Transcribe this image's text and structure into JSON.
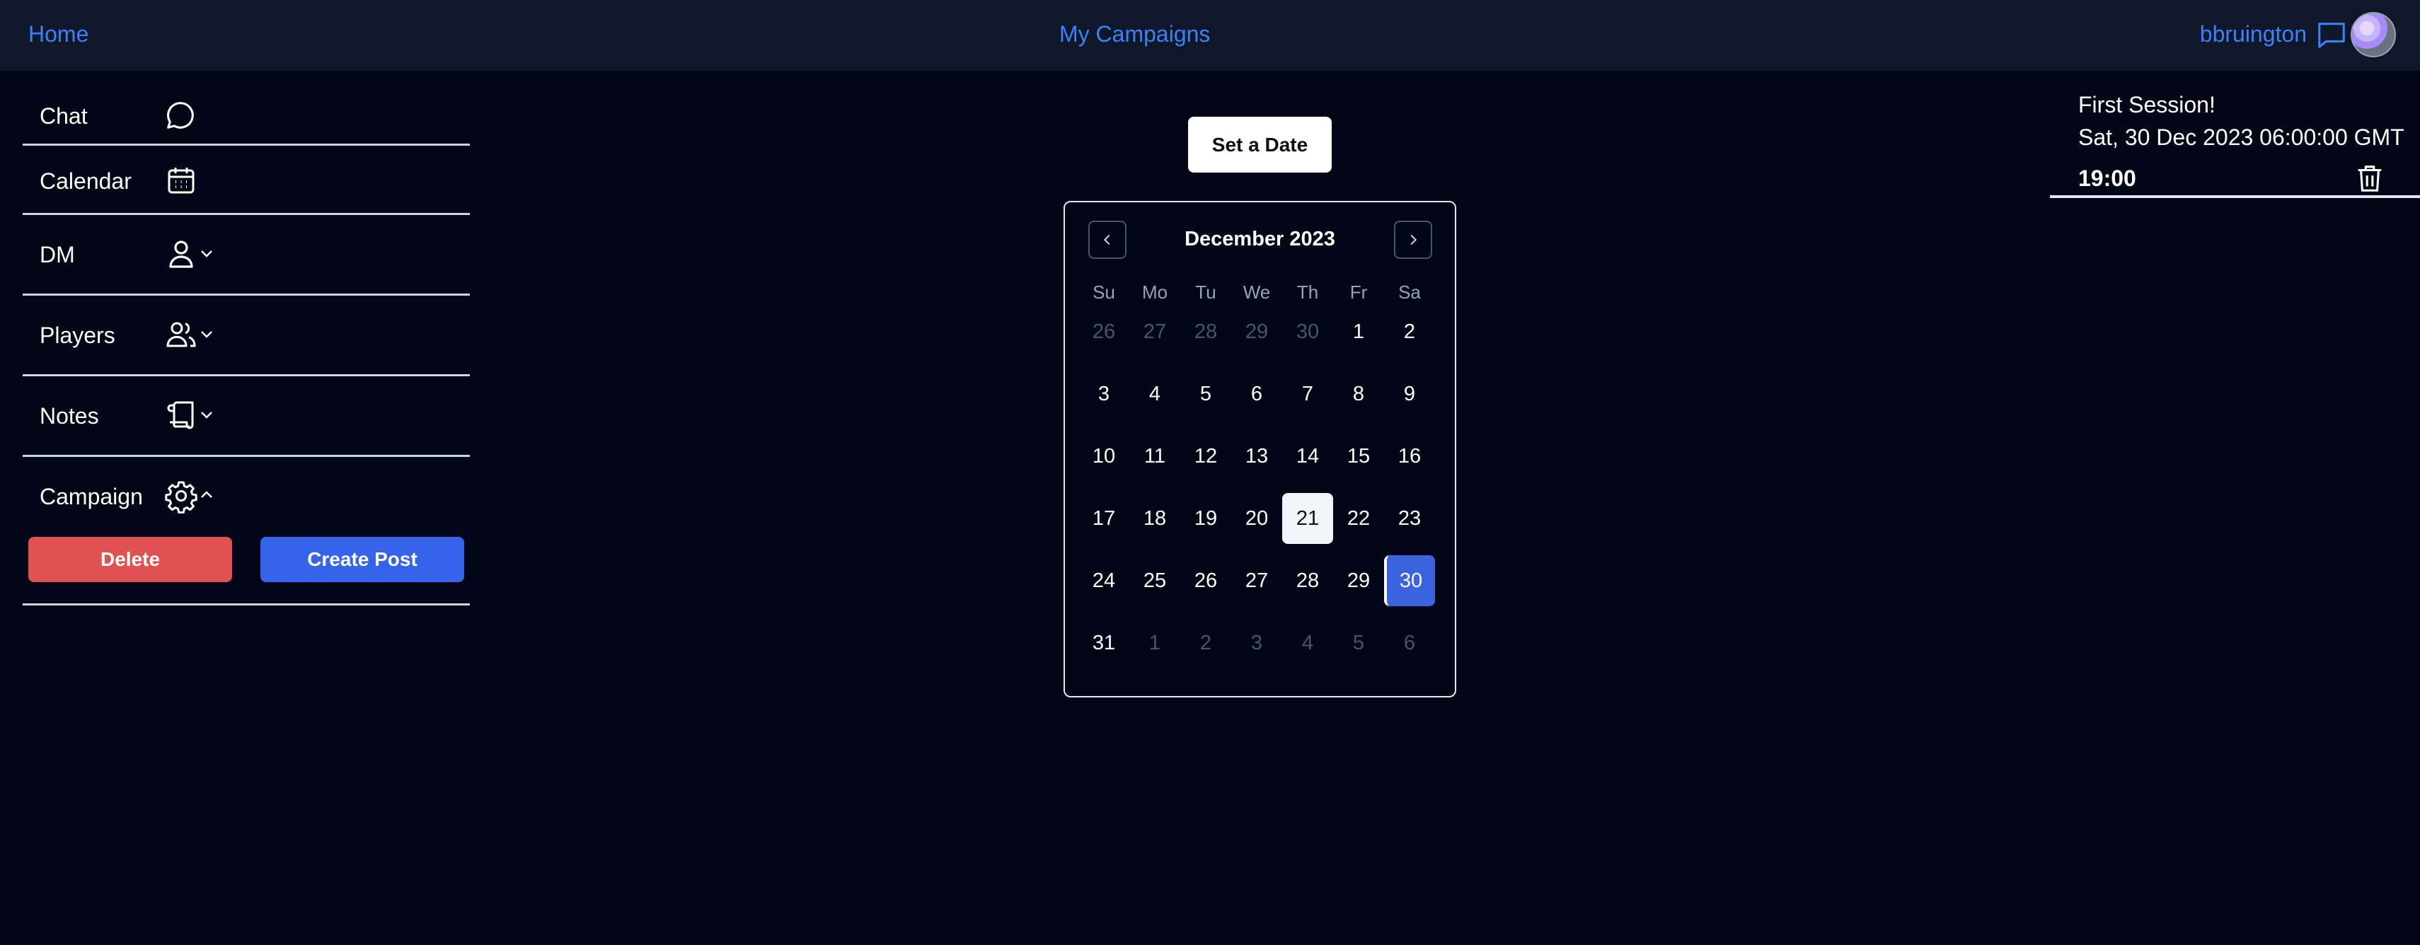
{
  "topbar": {
    "home": "Home",
    "center": "My Campaigns",
    "username": "bbruington"
  },
  "sidebar": {
    "items": [
      {
        "label": "Chat",
        "icon": "chat-bubble-icon"
      },
      {
        "label": "Calendar",
        "icon": "calendar-icon"
      },
      {
        "label": "DM",
        "icon": "user-icon"
      },
      {
        "label": "Players",
        "icon": "users-icon"
      },
      {
        "label": "Notes",
        "icon": "scroll-icon"
      },
      {
        "label": "Campaign",
        "icon": "gear-icon"
      }
    ],
    "campaign_actions": {
      "delete": "Delete",
      "create_post": "Create Post"
    }
  },
  "set_date_button": "Set a Date",
  "calendar": {
    "month_label": "December 2023",
    "weekdays": [
      "Su",
      "Mo",
      "Tu",
      "We",
      "Th",
      "Fr",
      "Sa"
    ],
    "weeks": [
      [
        "26",
        "27",
        "28",
        "29",
        "30",
        "1",
        "2"
      ],
      [
        "3",
        "4",
        "5",
        "6",
        "7",
        "8",
        "9"
      ],
      [
        "10",
        "11",
        "12",
        "13",
        "14",
        "15",
        "16"
      ],
      [
        "17",
        "18",
        "19",
        "20",
        "21",
        "22",
        "23"
      ],
      [
        "24",
        "25",
        "26",
        "27",
        "28",
        "29",
        "30"
      ],
      [
        "31",
        "1",
        "2",
        "3",
        "4",
        "5",
        "6"
      ]
    ],
    "today": "21",
    "selected": "30"
  },
  "event": {
    "title": "First Session!",
    "date": "Sat, 30 Dec 2023 06:00:00 GMT",
    "time": "19:00"
  },
  "colors": {
    "background": "#020617",
    "topbar": "#0f172a",
    "link": "#3b82f6",
    "delete": "#e05252",
    "create": "#3563e9",
    "selected_day": "#3b63e0"
  }
}
